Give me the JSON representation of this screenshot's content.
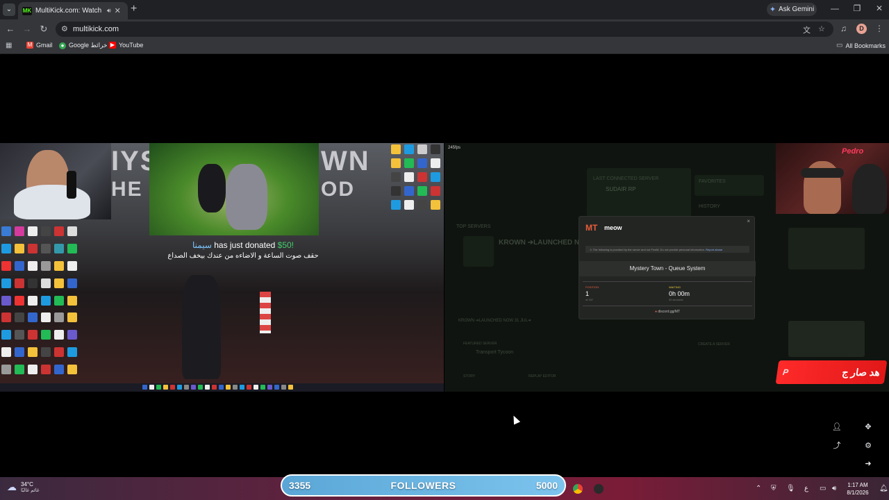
{
  "browser": {
    "tab_title": "MultiKick.com: Watch Multi",
    "tab_favicon": "MK",
    "url": "multikick.com",
    "ask_gemini": "Ask Gemini",
    "profile_initial": "D",
    "bookmarks": [
      {
        "label": "Gmail",
        "icon": "gmail-icon",
        "color": "#ea4335"
      },
      {
        "label": "Google خرائط",
        "icon": "maps-icon",
        "color": "#34a853"
      },
      {
        "label": "YouTube",
        "icon": "youtube-icon",
        "color": "#ff0000"
      }
    ],
    "all_bookmarks": "All Bookmarks"
  },
  "left_stream": {
    "title_text_top": "IYS",
    "title_text_top_right": "WN",
    "title_text_bottom": "HE E",
    "title_text_bottom_right": "OD",
    "donation": {
      "name": "سيمنا",
      "message": "has just donated",
      "amount": "$50!",
      "subtitle": "حقف صوت الساعة و الاضاءه من عندك بيخف الصداع"
    }
  },
  "right_stream": {
    "fps": "245fps",
    "webcam_sign": "Pedro",
    "banner_text": "هد صار ج",
    "dim_labels": {
      "last_connected": "LAST CONNECTED SERVER",
      "server_name": "SUDAIR RP",
      "favorites": "FAVORITES",
      "history": "HISTORY",
      "top_servers": "TOP SERVERS",
      "krown": "KROWN ➔LAUNCHED N",
      "krown_small": "KROWN ➔LAUNCHED NOW 31 JUL➔",
      "featured": "FEATURED SERVER",
      "transport": "Transport Tycoon",
      "create": "CREATE A SERVER",
      "story": "STORY",
      "replay": "REPLAY EDITOR"
    },
    "modal": {
      "logo": "MT",
      "title": "meow",
      "close": "×",
      "notice": "The following is provided by the server and not FiveM. Do not provide personal information.",
      "notice_link": "Report abuse",
      "queue_title": "Mystery Town - Queue System",
      "position_label": "POSITION",
      "position_value": "1",
      "position_sub": "of 157",
      "waiting_label": "WAITING",
      "waiting_value": "0h 00m",
      "waiting_sub": "00 seconds",
      "discord": "discord.gg/MT"
    }
  },
  "taskbar": {
    "temp": "34°C",
    "condition": "غائم غالبًا",
    "followers_current": "3355",
    "followers_label": "FOLLOWERS",
    "followers_goal": "5000",
    "followers_progress": 0.671,
    "lang": "ع",
    "time": "1:17 AM",
    "date": "8/1/2026"
  },
  "colors": {
    "accent_green": "#53fc18",
    "banner_red": "#ff2a2a",
    "donation_green": "#43d06b"
  }
}
